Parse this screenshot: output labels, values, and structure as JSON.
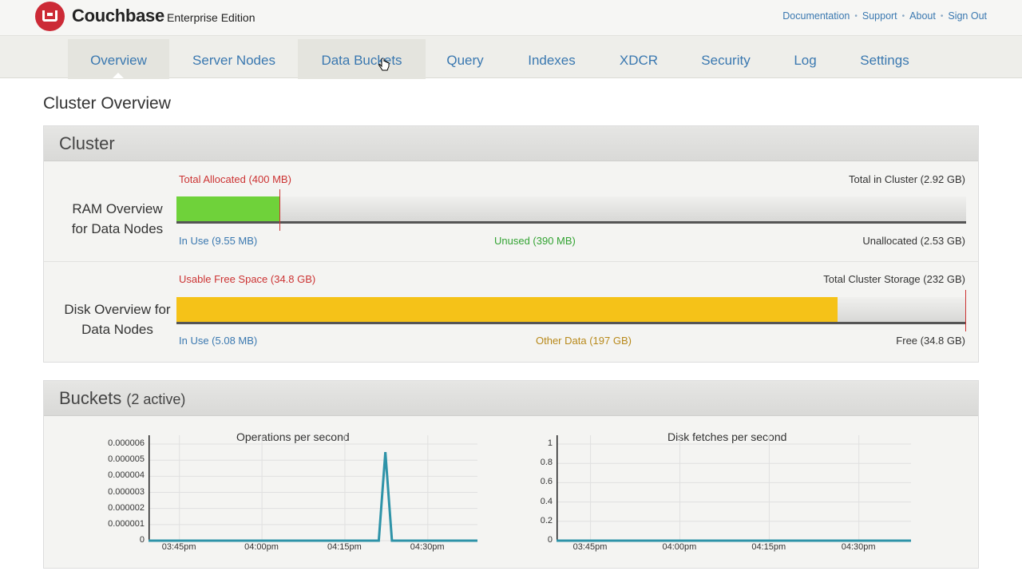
{
  "header": {
    "brand": "Couchbase",
    "edition": "Enterprise Edition",
    "links": [
      "Documentation",
      "Support",
      "About",
      "Sign Out"
    ]
  },
  "nav": {
    "items": [
      "Overview",
      "Server Nodes",
      "Data Buckets",
      "Query",
      "Indexes",
      "XDCR",
      "Security",
      "Log",
      "Settings"
    ],
    "active": "Overview",
    "hovered": "Data Buckets"
  },
  "page_title": "Cluster Overview",
  "cluster": {
    "title": "Cluster",
    "ram": {
      "label_line1": "RAM Overview",
      "label_line2": "for Data Nodes",
      "total_allocated": "Total Allocated (400 MB)",
      "total_in_cluster": "Total in Cluster (2.92 GB)",
      "in_use": "In Use (9.55 MB)",
      "unused": "Unused (390 MB)",
      "unallocated": "Unallocated (2.53 GB)",
      "used_fraction": 0.131
    },
    "disk": {
      "label_line1": "Disk Overview for",
      "label_line2": "Data Nodes",
      "usable_free": "Usable Free Space (34.8 GB)",
      "total_storage": "Total Cluster Storage (232 GB)",
      "in_use": "In Use (5.08 MB)",
      "other_data": "Other Data (197 GB)",
      "free": "Free (34.8 GB)",
      "used_fraction": 0.837
    }
  },
  "buckets": {
    "title": "Buckets",
    "subtitle": "(2 active)"
  },
  "colors": {
    "ram_fill": "#6fd23a",
    "disk_fill": "#f5c218",
    "link": "#3a78b0",
    "alert": "#cc3333",
    "chart_line": "#2e93a8"
  },
  "chart_data": [
    {
      "type": "line",
      "title": "Operations per second",
      "x_ticks": [
        "03:45pm",
        "04:00pm",
        "04:15pm",
        "04:30pm"
      ],
      "y_ticks": [
        "0",
        "0.000001",
        "0.000002",
        "0.000003",
        "0.000004",
        "0.000005",
        "0.000006"
      ],
      "ylim": [
        0,
        6.3e-06
      ],
      "series": [
        {
          "values": [
            [
              0,
              0
            ],
            [
              0.7,
              0
            ],
            [
              0.72,
              5.5e-06
            ],
            [
              0.74,
              0
            ],
            [
              1,
              0
            ]
          ]
        }
      ]
    },
    {
      "type": "line",
      "title": "Disk fetches per second",
      "x_ticks": [
        "03:45pm",
        "04:00pm",
        "04:15pm",
        "04:30pm"
      ],
      "y_ticks": [
        "0",
        "0.2",
        "0.4",
        "0.6",
        "0.8",
        "1"
      ],
      "ylim": [
        0,
        1.05
      ],
      "series": [
        {
          "values": [
            [
              0,
              0
            ],
            [
              1,
              0
            ]
          ]
        }
      ]
    }
  ]
}
